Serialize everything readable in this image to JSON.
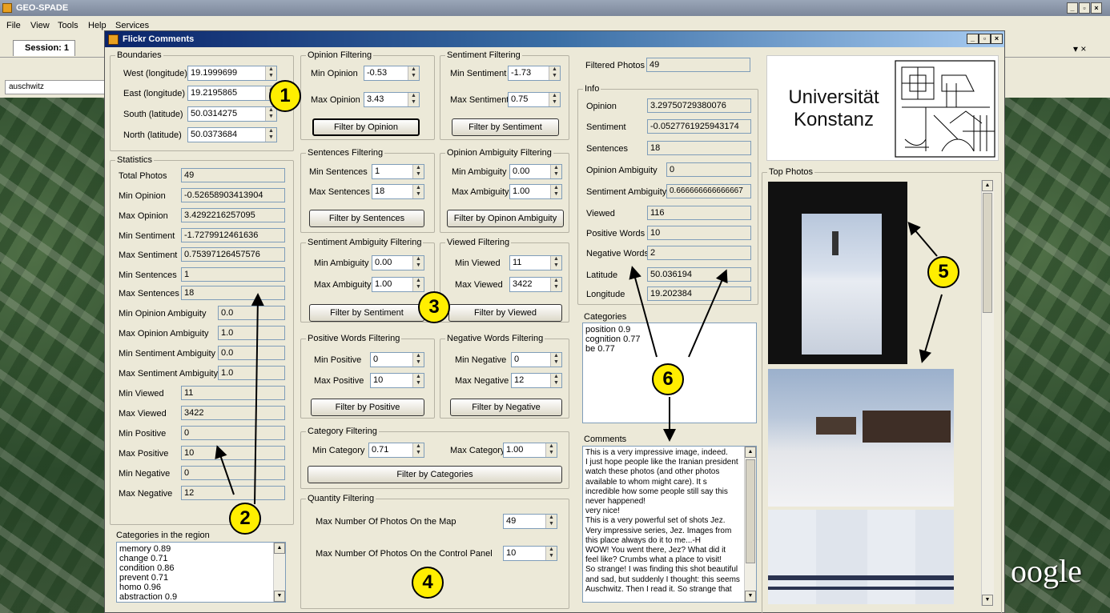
{
  "app": {
    "title": "GEO-SPADE",
    "menu": [
      "File",
      "View",
      "Tools",
      "Help",
      "Services"
    ],
    "session_tab": "Session: 1",
    "search_value": "auschwitz",
    "google_logo": "oogle"
  },
  "dialog": {
    "title": "Flickr Comments"
  },
  "boundaries": {
    "label": "Boundaries",
    "fields": [
      {
        "label": "West (longitude)",
        "value": "19.1999699"
      },
      {
        "label": "East (longitude)",
        "value": "19.2195865"
      },
      {
        "label": "South (latitude)",
        "value": "50.0314275"
      },
      {
        "label": "North (latitude)",
        "value": "50.0373684"
      }
    ]
  },
  "statistics": {
    "label": "Statistics",
    "fields": [
      {
        "label": "Total Photos",
        "value": "49"
      },
      {
        "label": "Min Opinion",
        "value": "-0.52658903413904"
      },
      {
        "label": "Max Opinion",
        "value": "3.4292216257095"
      },
      {
        "label": "Min Sentiment",
        "value": "-1.7279912461636"
      },
      {
        "label": "Max Sentiment",
        "value": "0.75397126457576"
      },
      {
        "label": "Min Sentences",
        "value": "1"
      },
      {
        "label": "Max Sentences",
        "value": "18"
      },
      {
        "label": "Min Opinion Ambiguity",
        "value": "0.0"
      },
      {
        "label": "Max Opinion Ambiguity",
        "value": "1.0"
      },
      {
        "label": "Min Sentiment Ambiguity",
        "value": "0.0"
      },
      {
        "label": "Max Sentiment Ambiguity",
        "value": "1.0"
      },
      {
        "label": "Min Viewed",
        "value": "11"
      },
      {
        "label": "Max Viewed",
        "value": "3422"
      },
      {
        "label": "Min Positive",
        "value": "0"
      },
      {
        "label": "Max Positive",
        "value": "10"
      },
      {
        "label": "Min Negative",
        "value": "0"
      },
      {
        "label": "Max Negative",
        "value": "12"
      }
    ]
  },
  "region_categories": {
    "label": "Categories in the region",
    "items": [
      "memory 0.89",
      "change 0.71",
      "condition 0.86",
      "prevent 0.71",
      "homo 0.96",
      "abstraction 0.9"
    ]
  },
  "filters": {
    "opinion": {
      "label": "Opinion Filtering",
      "min_label": "Min Opinion",
      "min": "-0.53",
      "max_label": "Max Opinion",
      "max": "3.43",
      "button": "Filter by Opinion"
    },
    "sentiment": {
      "label": "Sentiment Filtering",
      "min_label": "Min Sentiment",
      "min": "-1.73",
      "max_label": "Max Sentiment",
      "max": "0.75",
      "button": "Filter by Sentiment"
    },
    "sentences": {
      "label": "Sentences Filtering",
      "min_label": "Min Sentences",
      "min": "1",
      "max_label": "Max Sentences",
      "max": "18",
      "button": "Filter by Sentences"
    },
    "opinion_ambiguity": {
      "label": "Opinion Ambiguity Filtering",
      "min_label": "Min Ambiguity",
      "min": "0.00",
      "max_label": "Max Ambiguity",
      "max": "1.00",
      "button": "Filter by Opinon Ambiguity"
    },
    "sentiment_ambiguity": {
      "label": "Sentiment Ambiguity Filtering",
      "min_label": "Min Ambiguity",
      "min": "0.00",
      "max_label": "Max Ambiguity",
      "max": "1.00",
      "button": "Filter by Sentiment"
    },
    "viewed": {
      "label": "Viewed Filtering",
      "min_label": "Min Viewed",
      "min": "11",
      "max_label": "Max Viewed",
      "max": "3422",
      "button": "Filter by Viewed"
    },
    "positive": {
      "label": "Positive Words Filtering",
      "min_label": "Min Positive",
      "min": "0",
      "max_label": "Max Positive",
      "max": "10",
      "button": "Filter by Positive"
    },
    "negative": {
      "label": "Negative Words Filtering",
      "min_label": "Min Negative",
      "min": "0",
      "max_label": "Max Negative",
      "max": "12",
      "button": "Filter by Negative"
    },
    "category": {
      "label": "Category Filtering",
      "min_label": "Min Category",
      "min": "0.71",
      "max_label": "Max Category",
      "max": "1.00",
      "button": "Filter by Categories"
    },
    "quantity": {
      "label": "Quantity Filtering",
      "map_label": "Max Number Of Photos On the Map",
      "map": "49",
      "panel_label": "Max Number Of Photos On the Control Panel",
      "panel": "10"
    }
  },
  "filtered": {
    "label": "Filtered Photos",
    "value": "49"
  },
  "info": {
    "label": "Info",
    "fields": [
      {
        "label": "Opinion",
        "value": "3.29750729380076"
      },
      {
        "label": "Sentiment",
        "value": "-0.0527761925943174"
      },
      {
        "label": "Sentences",
        "value": "18"
      },
      {
        "label": "Opinion Ambiguity",
        "value": "0"
      },
      {
        "label": "Sentiment Ambiguity",
        "value": "0.666666666666667"
      },
      {
        "label": "Viewed",
        "value": "116"
      },
      {
        "label": "Positive Words",
        "value": "10"
      },
      {
        "label": "Negative Words",
        "value": "2"
      },
      {
        "label": "Latitude",
        "value": "50.036194"
      },
      {
        "label": "Longitude",
        "value": "19.202384"
      }
    ]
  },
  "categories": {
    "label": "Categories",
    "items": [
      "position 0.9",
      "cognition 0.77",
      "be 0.77"
    ]
  },
  "comments": {
    "label": "Comments",
    "lines": [
      "This is a very impressive image, indeed.",
      "I just hope people like the Iranian president",
      "watch these photos (and other photos",
      "available to whom might care). It s",
      "incredible how some people still say this",
      "never happened!",
      "very nice!",
      "This is a very powerful set of shots Jez.",
      "Very impressive series, Jez. Images from",
      "this place always do it to me...-H",
      "WOW! You went there, Jez? What did it",
      "feel like? Crumbs what a place to visit!",
      "So strange! I was finding this shot  beautiful",
      "and sad, but suddenly I thought: this seems",
      "Auschwitz. Then I read it. So strange that"
    ]
  },
  "logo": {
    "line1": "Universität",
    "line2": "Konstanz"
  },
  "top_photos": {
    "label": "Top Photos"
  },
  "callouts": [
    "1",
    "2",
    "3",
    "4",
    "5",
    "6"
  ]
}
